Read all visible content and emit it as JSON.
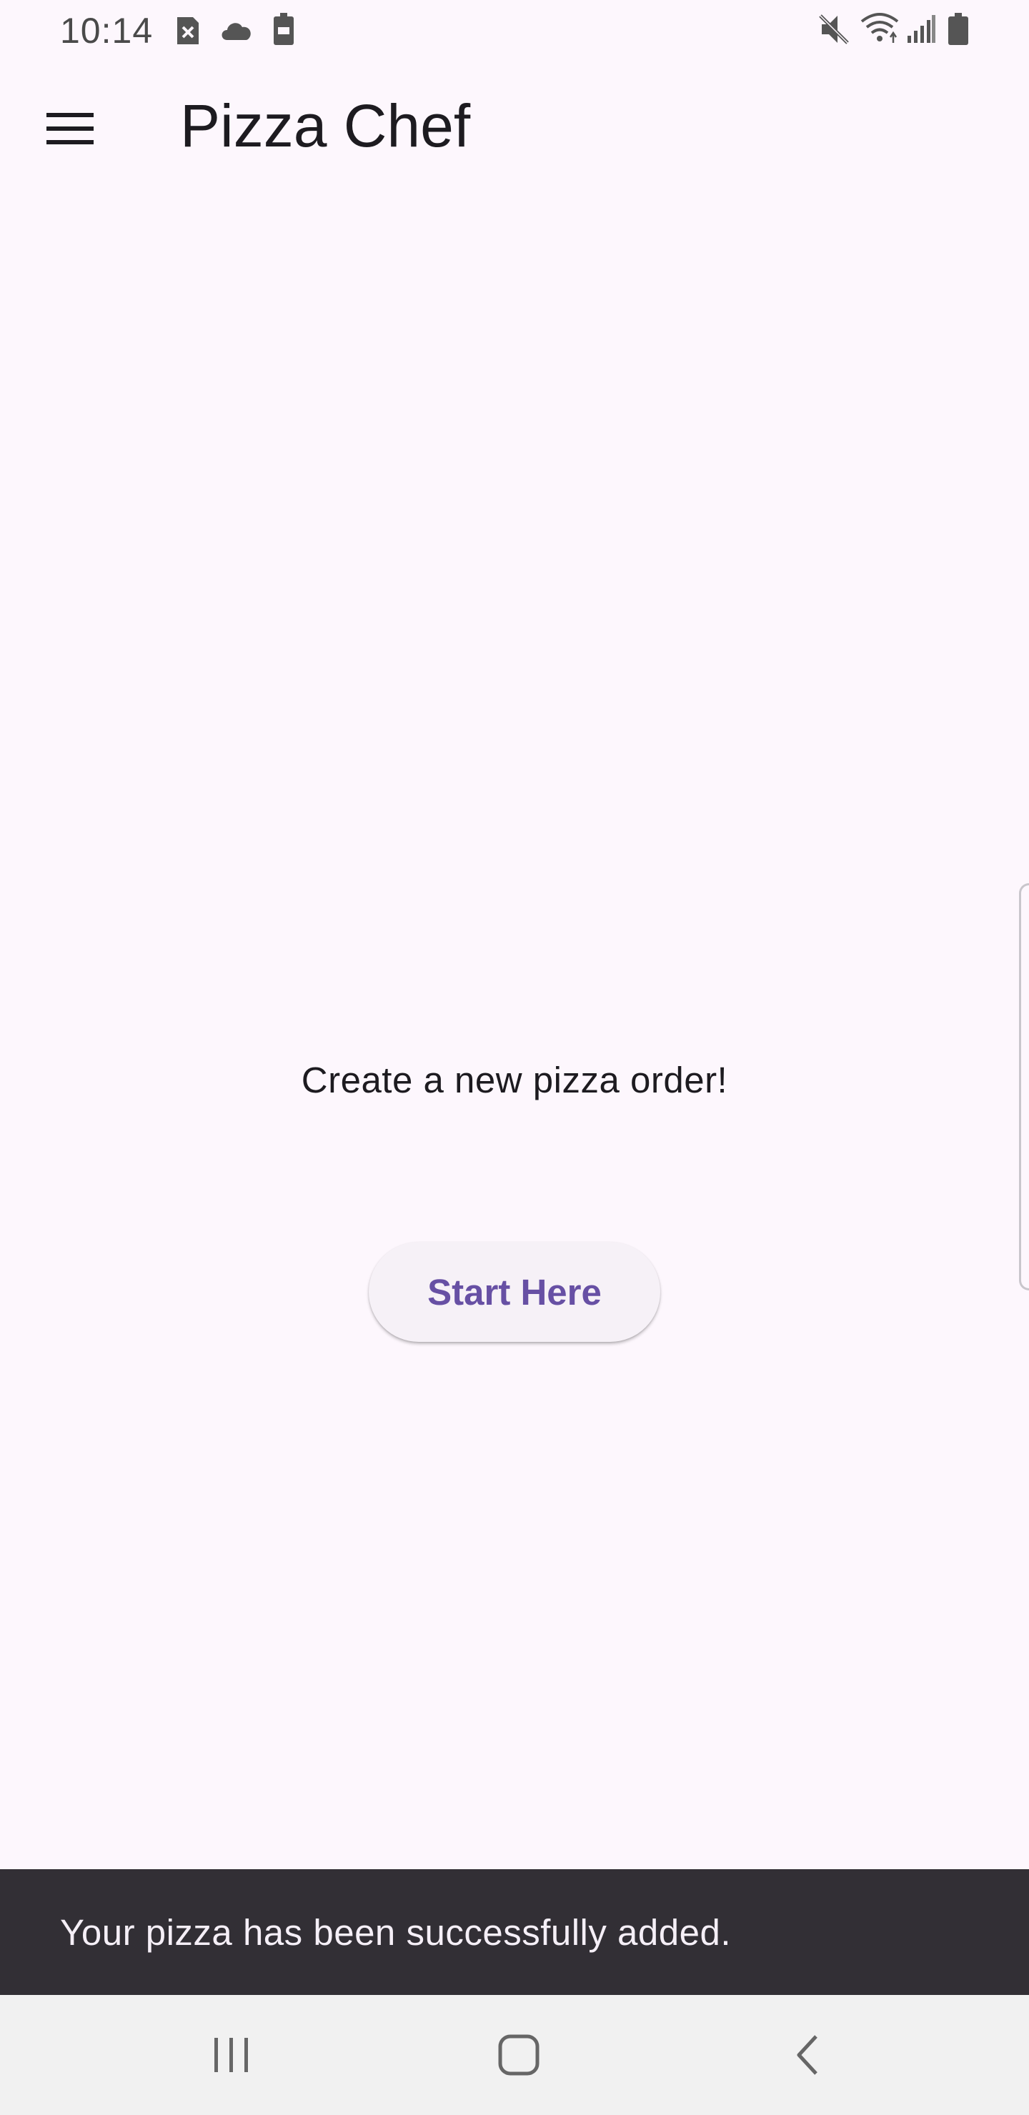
{
  "status_bar": {
    "time": "10:14",
    "icons": [
      "sim-error-icon",
      "cloud-icon",
      "battery-saver-icon",
      "mute-icon",
      "wifi-icon",
      "signal-icon",
      "battery-icon"
    ]
  },
  "app_bar": {
    "title": "Pizza Chef",
    "menu_icon": "menu-icon"
  },
  "main": {
    "prompt": "Create a new pizza order!",
    "start_button_label": "Start Here"
  },
  "snackbar": {
    "message": "Your pizza has been successfully added."
  },
  "nav_bar": {
    "buttons": [
      "recents-icon",
      "home-icon",
      "back-icon"
    ]
  },
  "colors": {
    "background": "#fdf7fd",
    "primary": "#6750a4",
    "snackbar": "#322f35",
    "nav_bar": "#f1f1f1"
  }
}
